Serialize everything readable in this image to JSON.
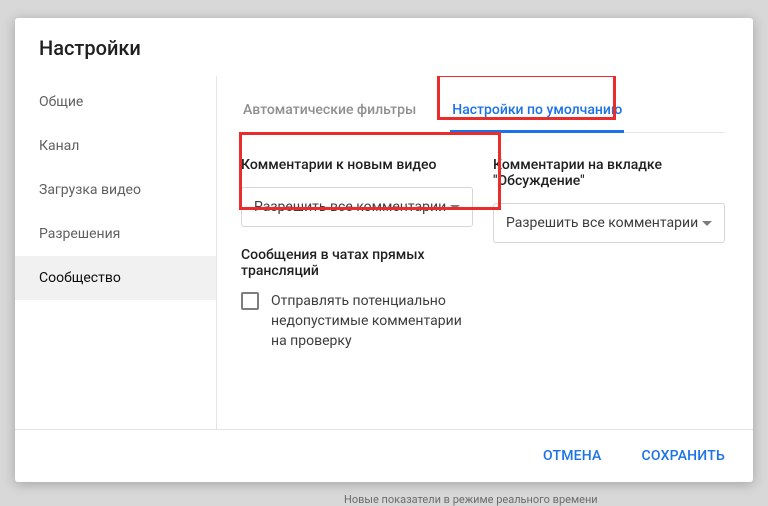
{
  "dialog": {
    "title": "Настройки"
  },
  "sidebar": {
    "items": [
      {
        "label": "Общие"
      },
      {
        "label": "Канал"
      },
      {
        "label": "Загрузка видео"
      },
      {
        "label": "Разрешения"
      },
      {
        "label": "Сообщество"
      }
    ],
    "active_index": 4
  },
  "tabs": {
    "items": [
      {
        "label": "Автоматические фильтры"
      },
      {
        "label": "Настройки по умолчанию"
      }
    ],
    "active_index": 1
  },
  "sections": {
    "new_video": {
      "label": "Комментарии к новым видео",
      "select_value": "Разрешить все комментарии"
    },
    "discussion": {
      "label": "Комментарии на вкладке \"Обсуждение\"",
      "select_value": "Разрешить все комментарии"
    },
    "live_chat": {
      "label": "Сообщения в чатах прямых трансляций",
      "checkbox_label": "Отправлять потенциально недопустимые комментарии на проверку",
      "checkbox_checked": false
    }
  },
  "footer": {
    "cancel": "ОТМЕНА",
    "save": "СОХРАНИТЬ"
  },
  "background_snippet": "Новые показатели в режиме реального времени"
}
